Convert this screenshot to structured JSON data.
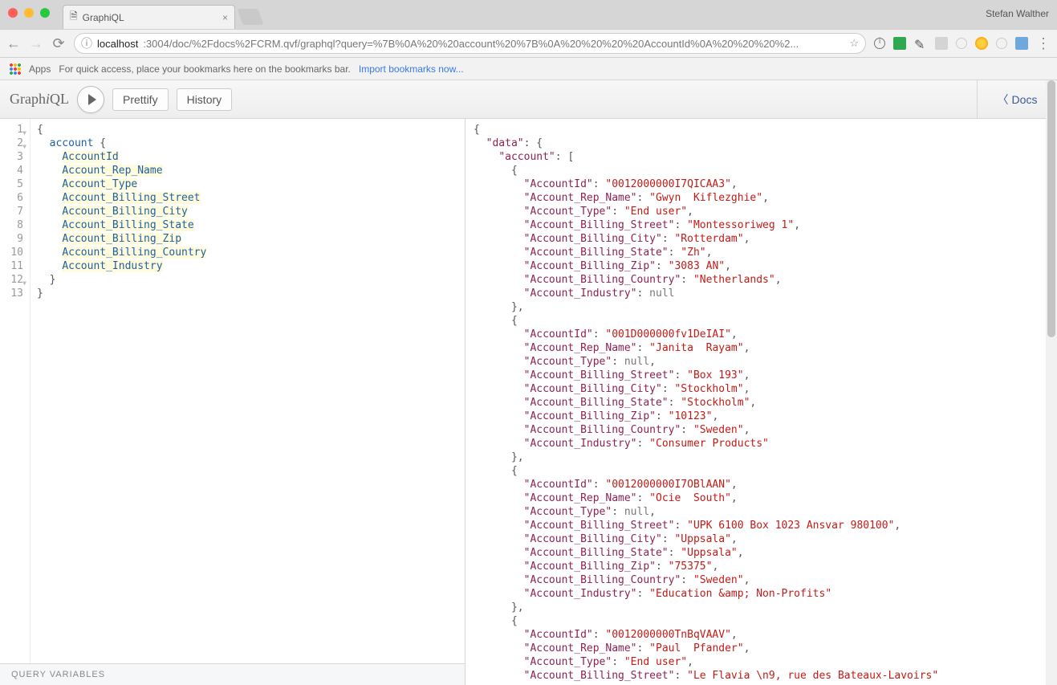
{
  "browser": {
    "tab_title": "GraphiQL",
    "profile_name": "Stefan Walther",
    "url_host": "localhost",
    "url_port_path": ":3004/doc/%2Fdocs%2FCRM.qvf/graphql?query=%7B%0A%20%20account%20%7B%0A%20%20%20%20AccountId%0A%20%20%20%2...",
    "apps_label": "Apps",
    "bookmarks_hint": "For quick access, place your bookmarks here on the bookmarks bar.",
    "import_link": "Import bookmarks now..."
  },
  "graphiql": {
    "logo_pre": "Graph",
    "logo_i": "i",
    "logo_post": "QL",
    "btn_prettify": "Prettify",
    "btn_history": "History",
    "btn_docs": "Docs",
    "query_root": "account",
    "query_fields": [
      "AccountId",
      "Account_Rep_Name",
      "Account_Type",
      "Account_Billing_Street",
      "Account_Billing_City",
      "Account_Billing_State",
      "Account_Billing_Zip",
      "Account_Billing_Country",
      "Account_Industry"
    ],
    "vars_label": "QUERY VARIABLES"
  },
  "result": {
    "data_key": "data",
    "account_key": "account",
    "records": [
      {
        "AccountId": "0012000000I7QICAA3",
        "Account_Rep_Name": "Gwyn  Kiflezghie",
        "Account_Type": "End user",
        "Account_Billing_Street": "Montessoriweg 1",
        "Account_Billing_City": "Rotterdam",
        "Account_Billing_State": "Zh",
        "Account_Billing_Zip": "3083 AN",
        "Account_Billing_Country": "Netherlands",
        "Account_Industry": null
      },
      {
        "AccountId": "001D000000fv1DeIAI",
        "Account_Rep_Name": "Janita  Rayam",
        "Account_Type": null,
        "Account_Billing_Street": "Box 193",
        "Account_Billing_City": "Stockholm",
        "Account_Billing_State": "Stockholm",
        "Account_Billing_Zip": "10123",
        "Account_Billing_Country": "Sweden",
        "Account_Industry": "Consumer Products"
      },
      {
        "AccountId": "0012000000I7OBlAAN",
        "Account_Rep_Name": "Ocie  South",
        "Account_Type": null,
        "Account_Billing_Street": "UPK 6100 Box 1023 Ansvar 980100",
        "Account_Billing_City": "Uppsala",
        "Account_Billing_State": "Uppsala",
        "Account_Billing_Zip": "75375",
        "Account_Billing_Country": "Sweden",
        "Account_Industry": "Education &amp;amp; Non-Profits"
      },
      {
        "AccountId": "0012000000TnBqVAAV",
        "Account_Rep_Name": "Paul  Pfander",
        "Account_Type": "End user",
        "Account_Billing_Street": "Le Flavia \\n9, rue des Bateaux-Lavoirs"
      }
    ]
  }
}
